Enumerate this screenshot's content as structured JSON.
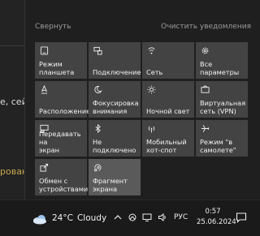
{
  "background": {
    "text1": "е, сей",
    "text2": "рован"
  },
  "action_center": {
    "collapse_label": "Свернуть",
    "clear_label": "Очистить уведомления",
    "tiles": [
      {
        "label": "Режим\nпланшета",
        "icon": "tablet-mode-icon"
      },
      {
        "label": "Подключение",
        "icon": "connect-icon"
      },
      {
        "label": "Сеть",
        "icon": "network-icon"
      },
      {
        "label": "Все\nпараметры",
        "icon": "gear-icon"
      },
      {
        "label": "Расположение",
        "icon": "location-icon"
      },
      {
        "label": "Фокусировка\nвнимания",
        "icon": "moon-icon"
      },
      {
        "label": "Ночной свет",
        "icon": "brightness-icon"
      },
      {
        "label": "Виртуальная\nсеть (VPN)",
        "icon": "vpn-icon"
      },
      {
        "label": "Передавать на\nэкран",
        "icon": "project-icon"
      },
      {
        "label": "Не\nподключено",
        "icon": "bluetooth-icon"
      },
      {
        "label": "Мобильный\nхот-спот",
        "icon": "hotspot-icon"
      },
      {
        "label": "Режим \"в\nсамолете\"",
        "icon": "airplane-icon"
      },
      {
        "label": "Обмен с\nустройствами",
        "icon": "share-icon"
      },
      {
        "label": "Фрагмент\nэкрана",
        "icon": "screen-snip-icon"
      }
    ]
  },
  "taskbar": {
    "weather_temp": "24°C",
    "weather_condition": "Cloudy",
    "language": "РУС",
    "time": "0:57",
    "date": "25.06.2024"
  }
}
